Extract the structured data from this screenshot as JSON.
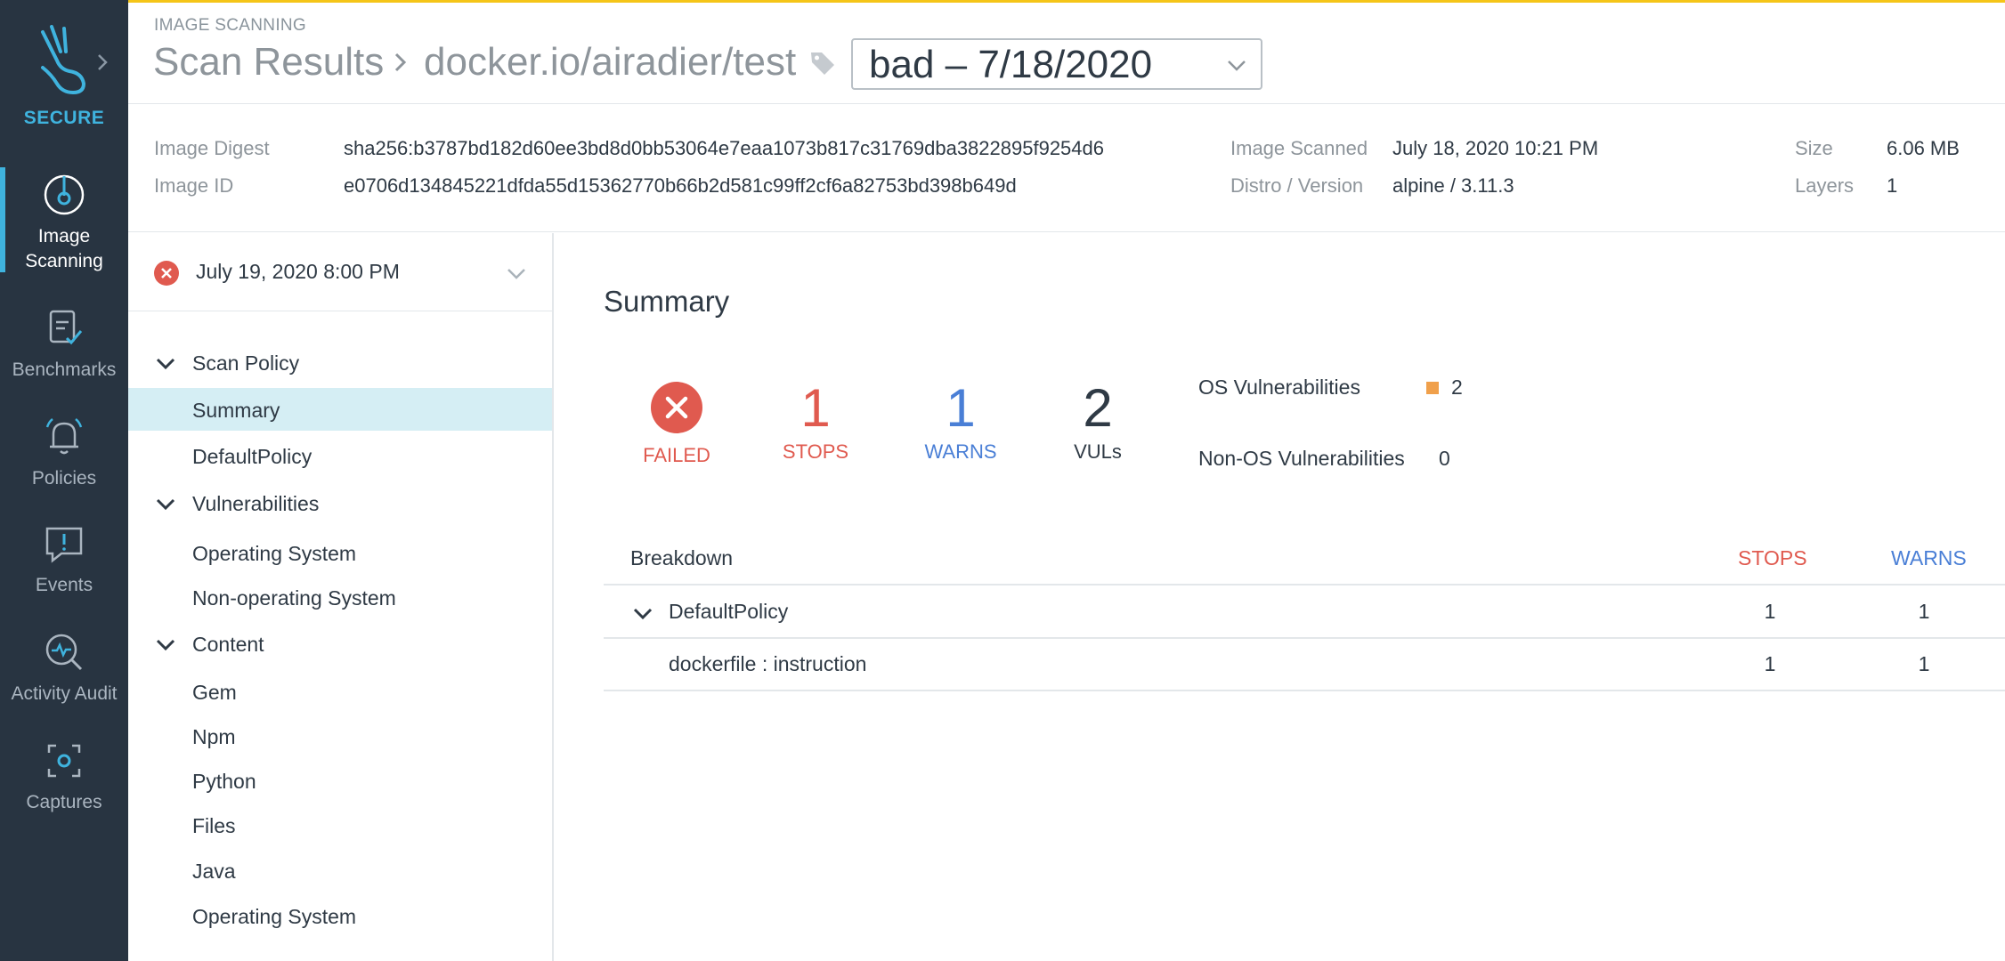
{
  "app": {
    "brand": "SECURE",
    "nav": [
      {
        "label_line1": "Image",
        "label_line2": "Scanning",
        "icon": "image-scanning-icon",
        "active": true
      },
      {
        "label": "Benchmarks",
        "icon": "benchmarks-icon"
      },
      {
        "label": "Policies",
        "icon": "bell-icon"
      },
      {
        "label": "Events",
        "icon": "events-icon"
      },
      {
        "label": "Activity Audit",
        "icon": "activity-audit-icon"
      },
      {
        "label": "Captures",
        "icon": "captures-icon"
      }
    ]
  },
  "header": {
    "eyebrow": "IMAGE SCANNING",
    "crumb_root": "Scan Results",
    "crumb_image": "docker.io/airadier/test",
    "tag_selected": "bad – 7/18/2020"
  },
  "meta": {
    "digest_label": "Image Digest",
    "digest_value": "sha256:b3787bd182d60ee3bd8d0bb53064e7eaa1073b817c31769dba3822895f9254d6",
    "id_label": "Image ID",
    "id_value": "e0706d134845221dfda55d15362770b66b2d581c99ff2cf6a82753bd398b649d",
    "scanned_label": "Image Scanned",
    "scanned_value": "July 18, 2020 10:21 PM",
    "distro_label": "Distro / Version",
    "distro_value": "alpine / 3.11.3",
    "size_label": "Size",
    "size_value": "6.06 MB",
    "layers_label": "Layers",
    "layers_value": "1"
  },
  "left": {
    "run_selected": "July 19, 2020 8:00 PM",
    "groups": {
      "scan_policy": "Scan Policy",
      "vulnerabilities": "Vulnerabilities",
      "content": "Content"
    },
    "items": {
      "summary": "Summary",
      "default_policy": "DefaultPolicy",
      "operating_system": "Operating System",
      "non_operating_system": "Non-operating System",
      "gem": "Gem",
      "npm": "Npm",
      "python": "Python",
      "files": "Files",
      "java": "Java",
      "content_operating_system": "Operating System"
    }
  },
  "summary": {
    "title": "Summary",
    "status_label": "FAILED",
    "stops_value": "1",
    "stops_label": "STOPS",
    "warns_value": "1",
    "warns_label": "WARNS",
    "vuls_value": "2",
    "vuls_label": "VULs",
    "os_vuln_label": "OS Vulnerabilities",
    "os_vuln_value": "2",
    "non_os_vuln_label": "Non-OS Vulnerabilities",
    "non_os_vuln_value": "0"
  },
  "breakdown": {
    "header": "Breakdown",
    "stops_header": "STOPS",
    "warns_header": "WARNS",
    "rows": [
      {
        "name": "DefaultPolicy",
        "stops": "1",
        "warns": "1"
      },
      {
        "name": "dockerfile : instruction",
        "stops": "1",
        "warns": "1"
      }
    ]
  },
  "colors": {
    "accent": "#f5c518",
    "brand": "#3fb3de",
    "sidebar_bg": "#283441",
    "stop": "#e05a4f",
    "warn": "#4a7fd6",
    "selected_row": "#d5eef4",
    "os_vuln_marker": "#f0a04b"
  }
}
